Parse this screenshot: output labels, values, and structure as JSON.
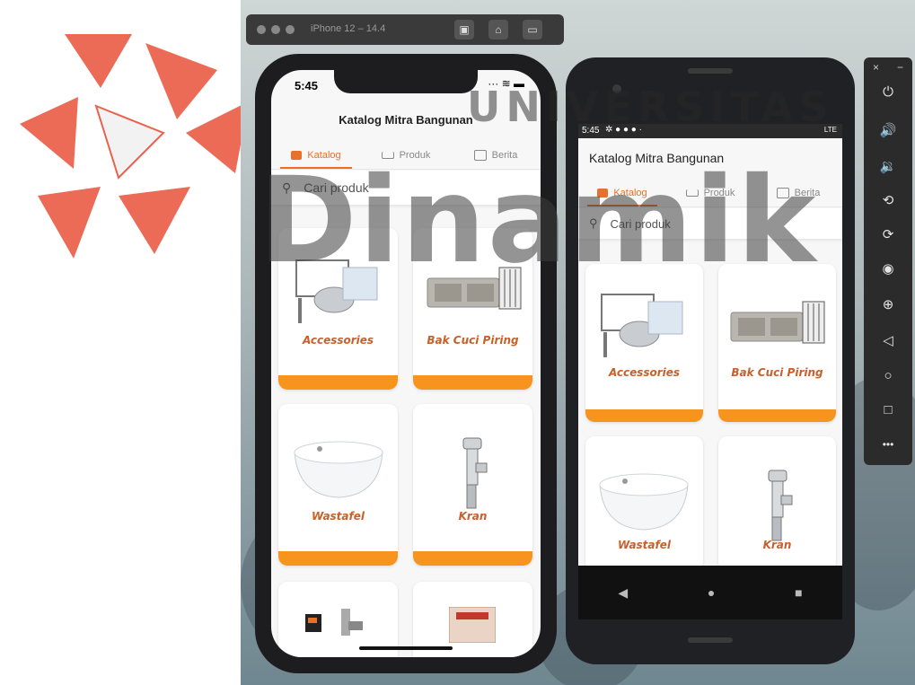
{
  "watermark": {
    "brand_text": "Dinamik",
    "university_text": "UNIVERSITAS",
    "colors": {
      "red": "#e8513a",
      "grey": "#3c3c3c"
    }
  },
  "simulator": {
    "title": "iPhone 12 – 14.4",
    "buttons": [
      {
        "icon": "screenshot-icon",
        "glyph": "▣"
      },
      {
        "icon": "home-icon",
        "glyph": "⌂"
      },
      {
        "icon": "rotate-icon",
        "glyph": "▭"
      }
    ]
  },
  "iphone": {
    "status_time": "5:45",
    "status_icons": "···  ≋ ▬",
    "app_title": "Katalog Mitra Bangunan",
    "tabs": [
      {
        "label": "Katalog",
        "icon": "catalog-icon",
        "active": true
      },
      {
        "label": "Produk",
        "icon": "sink-icon",
        "active": false
      },
      {
        "label": "Berita",
        "icon": "news-icon",
        "active": false
      }
    ],
    "search_placeholder": "Cari produk",
    "cards": [
      {
        "label": "Accessories",
        "image": "accessories-image"
      },
      {
        "label": "Bak Cuci Piring",
        "image": "sink-image"
      },
      {
        "label": "Wastafel",
        "image": "washbasin-image"
      },
      {
        "label": "Kran",
        "image": "faucet-image"
      },
      {
        "label": "",
        "image": "product-image"
      },
      {
        "label": "",
        "image": "product-box-image"
      }
    ]
  },
  "android": {
    "status_time": "5:45",
    "status_right": "LTE",
    "app_title": "Katalog Mitra Bangunan",
    "tabs": [
      {
        "label": "Katalog",
        "icon": "catalog-icon",
        "active": true
      },
      {
        "label": "Produk",
        "icon": "sink-icon",
        "active": false
      },
      {
        "label": "Berita",
        "icon": "news-icon",
        "active": false
      }
    ],
    "search_placeholder": "Cari produk",
    "cards": [
      {
        "label": "Accessories",
        "image": "accessories-image"
      },
      {
        "label": "Bak Cuci Piring",
        "image": "sink-image"
      },
      {
        "label": "Wastafel",
        "image": "washbasin-image"
      },
      {
        "label": "Kran",
        "image": "faucet-image"
      }
    ],
    "nav": [
      {
        "icon": "back-icon",
        "glyph": "◀"
      },
      {
        "icon": "home-icon",
        "glyph": "●"
      },
      {
        "icon": "recents-icon",
        "glyph": "■"
      }
    ]
  },
  "emulator_panel": {
    "close": "×",
    "minimize": "−",
    "buttons": [
      {
        "icon": "power-icon",
        "glyph": "⏻"
      },
      {
        "icon": "volume-up-icon",
        "glyph": "🔊"
      },
      {
        "icon": "volume-down-icon",
        "glyph": "🔉"
      },
      {
        "icon": "rotate-left-icon",
        "glyph": "⟲"
      },
      {
        "icon": "rotate-right-icon",
        "glyph": "⟳"
      },
      {
        "icon": "camera-icon",
        "glyph": "◉"
      },
      {
        "icon": "zoom-icon",
        "glyph": "⊕"
      },
      {
        "icon": "back-icon",
        "glyph": "◁"
      },
      {
        "icon": "home-icon",
        "glyph": "○"
      },
      {
        "icon": "overview-icon",
        "glyph": "□"
      },
      {
        "icon": "more-icon",
        "glyph": "•••"
      }
    ]
  },
  "accent_color": "#f7941d"
}
